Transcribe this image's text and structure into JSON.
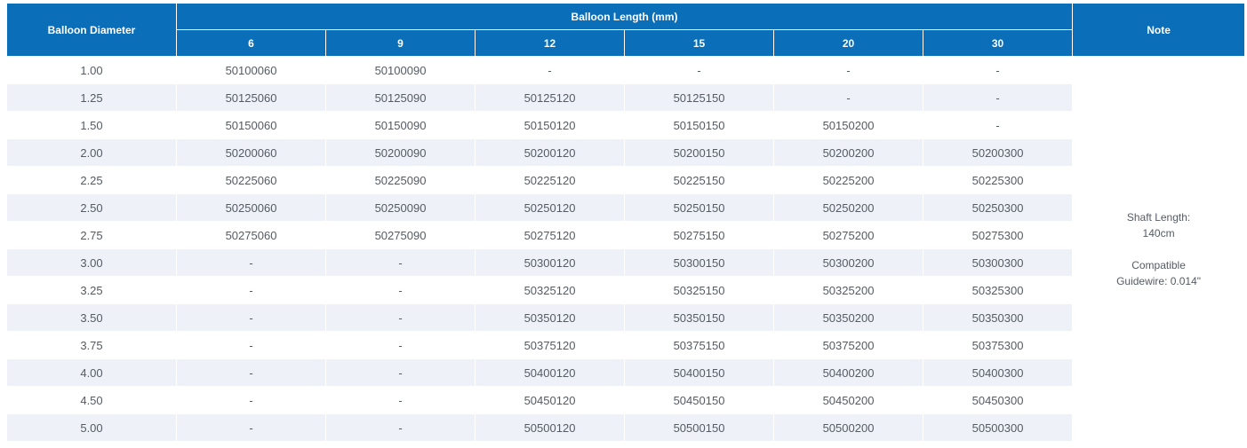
{
  "header": {
    "diameter_label": "Balloon Diameter",
    "length_label": "Balloon Length (mm)",
    "note_label": "Note",
    "lengths": [
      "6",
      "9",
      "12",
      "15",
      "20",
      "30"
    ]
  },
  "rows": [
    {
      "diameter": "1.00",
      "cells": [
        "50100060",
        "50100090",
        "-",
        "-",
        "-",
        "-"
      ]
    },
    {
      "diameter": "1.25",
      "cells": [
        "50125060",
        "50125090",
        "50125120",
        "50125150",
        "-",
        "-"
      ]
    },
    {
      "diameter": "1.50",
      "cells": [
        "50150060",
        "50150090",
        "50150120",
        "50150150",
        "50150200",
        "-"
      ]
    },
    {
      "diameter": "2.00",
      "cells": [
        "50200060",
        "50200090",
        "50200120",
        "50200150",
        "50200200",
        "50200300"
      ]
    },
    {
      "diameter": "2.25",
      "cells": [
        "50225060",
        "50225090",
        "50225120",
        "50225150",
        "50225200",
        "50225300"
      ]
    },
    {
      "diameter": "2.50",
      "cells": [
        "50250060",
        "50250090",
        "50250120",
        "50250150",
        "50250200",
        "50250300"
      ]
    },
    {
      "diameter": "2.75",
      "cells": [
        "50275060",
        "50275090",
        "50275120",
        "50275150",
        "50275200",
        "50275300"
      ]
    },
    {
      "diameter": "3.00",
      "cells": [
        "-",
        "-",
        "50300120",
        "50300150",
        "50300200",
        "50300300"
      ]
    },
    {
      "diameter": "3.25",
      "cells": [
        "-",
        "-",
        "50325120",
        "50325150",
        "50325200",
        "50325300"
      ]
    },
    {
      "diameter": "3.50",
      "cells": [
        "-",
        "-",
        "50350120",
        "50350150",
        "50350200",
        "50350300"
      ]
    },
    {
      "diameter": "3.75",
      "cells": [
        "-",
        "-",
        "50375120",
        "50375150",
        "50375200",
        "50375300"
      ]
    },
    {
      "diameter": "4.00",
      "cells": [
        "-",
        "-",
        "50400120",
        "50400150",
        "50400200",
        "50400300"
      ]
    },
    {
      "diameter": "4.50",
      "cells": [
        "-",
        "-",
        "50450120",
        "50450150",
        "50450200",
        "50450300"
      ]
    },
    {
      "diameter": "5.00",
      "cells": [
        "-",
        "-",
        "50500120",
        "50500150",
        "50500200",
        "50500300"
      ]
    }
  ],
  "note": {
    "shaft_line1": "Shaft Length:",
    "shaft_line2": "140cm",
    "guidewire_line1": "Compatible",
    "guidewire_line2": "Guidewire: 0.014\""
  },
  "colors": {
    "header_bg": "#0a6eb8",
    "stripe_bg": "#eef2f8",
    "text": "#555b63"
  }
}
